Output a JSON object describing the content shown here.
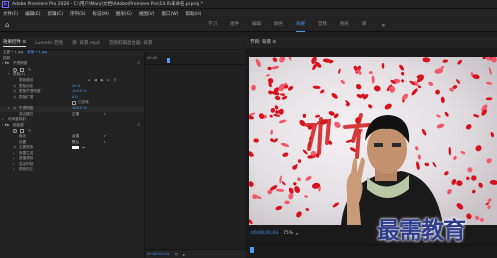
{
  "window": {
    "app_icon": "Pr",
    "title": "Adobe Premiere Pro 2020 - C:\\用户\\Mary\\文档\\Adobe\\Premiere Pro\\14.0\\未命名.prproj *"
  },
  "menu": [
    "文件(F)",
    "编辑(E)",
    "剪辑(C)",
    "序列(S)",
    "标记(M)",
    "图形(G)",
    "视图(V)",
    "窗口(W)",
    "帮助(H)"
  ],
  "workspace": {
    "home_icon": "home-icon",
    "tabs": [
      {
        "label": "学习",
        "active": false
      },
      {
        "label": "组件",
        "active": false
      },
      {
        "label": "编辑",
        "active": false
      },
      {
        "label": "颜色",
        "active": false
      },
      {
        "label": "效果",
        "active": true
      },
      {
        "label": "音频",
        "active": false
      },
      {
        "label": "图形",
        "active": false
      },
      {
        "label": "库",
        "active": false
      }
    ],
    "more": "»"
  },
  "left_panel": {
    "tabs": [
      {
        "label": "效果控件 ≡",
        "active": true
      },
      {
        "label": "Lumetri 范围",
        "active": false
      },
      {
        "label": "源: 背景.mp4",
        "active": false
      },
      {
        "label": "音频剪辑混合器: 背景",
        "active": false
      }
    ],
    "source_row": {
      "label": "主要 * 1.jpg",
      "clip": "背景 * 1.jpg"
    },
    "rows": {
      "video": "视频",
      "motion": "不透明度",
      "position": "蒙版(1)",
      "mask_path": "蒙版路径",
      "mask_feather_label": "蒙版羽化",
      "mask_feather_value": "20.0",
      "mask_opacity_label": "蒙版不透明度",
      "mask_opacity_value": "100.0 %",
      "mask_expand_label": "蒙版扩展",
      "mask_expand_value": "0.0",
      "inverted_label": "已反转",
      "opacity_label": "不透明度",
      "opacity_value": "100.0 %",
      "blend_label": "混合模式",
      "blend_value": "正常",
      "time_remap": "时间重映射",
      "ultra_key": "超级键",
      "output_label": "输出",
      "output_value": "合成",
      "setting_label": "设置",
      "setting_value": "默认",
      "key_color_label": "主要颜色",
      "matte_gen": "遮罩生成",
      "matte_cleanup": "遮罩清除",
      "spill": "溢出抑制",
      "color_correct": "颜色校正",
      "key_color_hex": "#ffffff"
    }
  },
  "timeline": {
    "start": "00:00",
    "current": "00:00:01:03",
    "status_time": "00:00:01:03"
  },
  "monitor": {
    "tab": "节目: 背景 ≡",
    "timecode": "00;00;01;03",
    "zoom": "75%"
  },
  "watermark": "最需教育"
}
